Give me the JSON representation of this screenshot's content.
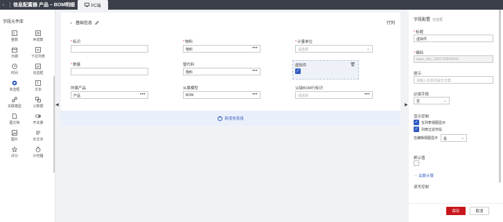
{
  "topbar": {
    "back": "‹",
    "title": "信息配置器 产品 – BOM明细",
    "tab_label": "PC端"
  },
  "sidebar": {
    "heading": "字段元件库",
    "items": [
      {
        "icon": "number-icon",
        "label": "整数"
      },
      {
        "icon": "sequence-icon",
        "label": "序成数"
      },
      {
        "icon": "date-icon",
        "label": "日期"
      },
      {
        "icon": "sublist-icon",
        "label": "下拉列表"
      },
      {
        "icon": "time-icon",
        "label": "时间"
      },
      {
        "icon": "checkbox-group-icon",
        "label": "勾选框"
      },
      {
        "icon": "radio-icon",
        "label": "单选框"
      },
      {
        "icon": "text-icon",
        "label": "文本"
      },
      {
        "icon": "link-icon",
        "label": "关联模型"
      },
      {
        "icon": "parent-icon",
        "label": "父数据"
      },
      {
        "icon": "document-icon",
        "label": "图文档"
      },
      {
        "icon": "toggle-icon",
        "label": "开关量"
      },
      {
        "icon": "image-icon",
        "label": "图片"
      },
      {
        "icon": "longtext-icon",
        "label": "长文本"
      },
      {
        "icon": "rating-icon",
        "label": "评分"
      },
      {
        "icon": "timer-icon",
        "label": "计时器"
      }
    ]
  },
  "canvas": {
    "section_title": "基础信息",
    "row_label": "行列",
    "fields": [
      {
        "label": "标识",
        "required": "*",
        "value": "",
        "kind": "text"
      },
      {
        "label": "物料",
        "required": "*",
        "value": "物料",
        "kind": "lookup"
      },
      {
        "label": "计量单位",
        "required": "*",
        "value": "请选择",
        "kind": "select"
      },
      {
        "label": "数量",
        "required": "*",
        "value": "",
        "kind": "text"
      },
      {
        "label": "替代料",
        "required": "",
        "value": "物料",
        "kind": "lookup"
      },
      {
        "label": "虚拟件",
        "required": "",
        "value": "",
        "kind": "checkbox"
      },
      {
        "label": "所属产品",
        "required": "",
        "value": "产品",
        "kind": "lookup"
      },
      {
        "label": "从属模型",
        "required": "",
        "value": "BOM",
        "kind": "lookup"
      },
      {
        "label": "父级BOM行标识",
        "required": "",
        "value": "请选择",
        "kind": "lookup"
      }
    ],
    "add_label": "新增信息组"
  },
  "panel": {
    "title": "字段配置",
    "subtitle": "勾选框",
    "title_label": "标题",
    "title_value": "虚拟件",
    "code_label": "编码",
    "code_value": "base_info_1691722843003",
    "hint_label": "提示",
    "hint_placeholder": "请输入信息的提示文案",
    "required_label": "必填字段",
    "required_value": "否",
    "display_label": "显示控制",
    "opt_show_in_table": "在列表视图显示",
    "opt_filter": "列表过滤字段",
    "edit_view_label": "在编辑视图显示",
    "edit_view_value": "是",
    "default_label": "默认值",
    "calc_link": "关联计算",
    "readwrite_label": "读写控制"
  },
  "footer": {
    "save": "保存",
    "cancel": "取消"
  },
  "colors": {
    "topbar": "#3b3f4a",
    "accent": "#2e5bbf",
    "primary_button": "#c8161d"
  }
}
